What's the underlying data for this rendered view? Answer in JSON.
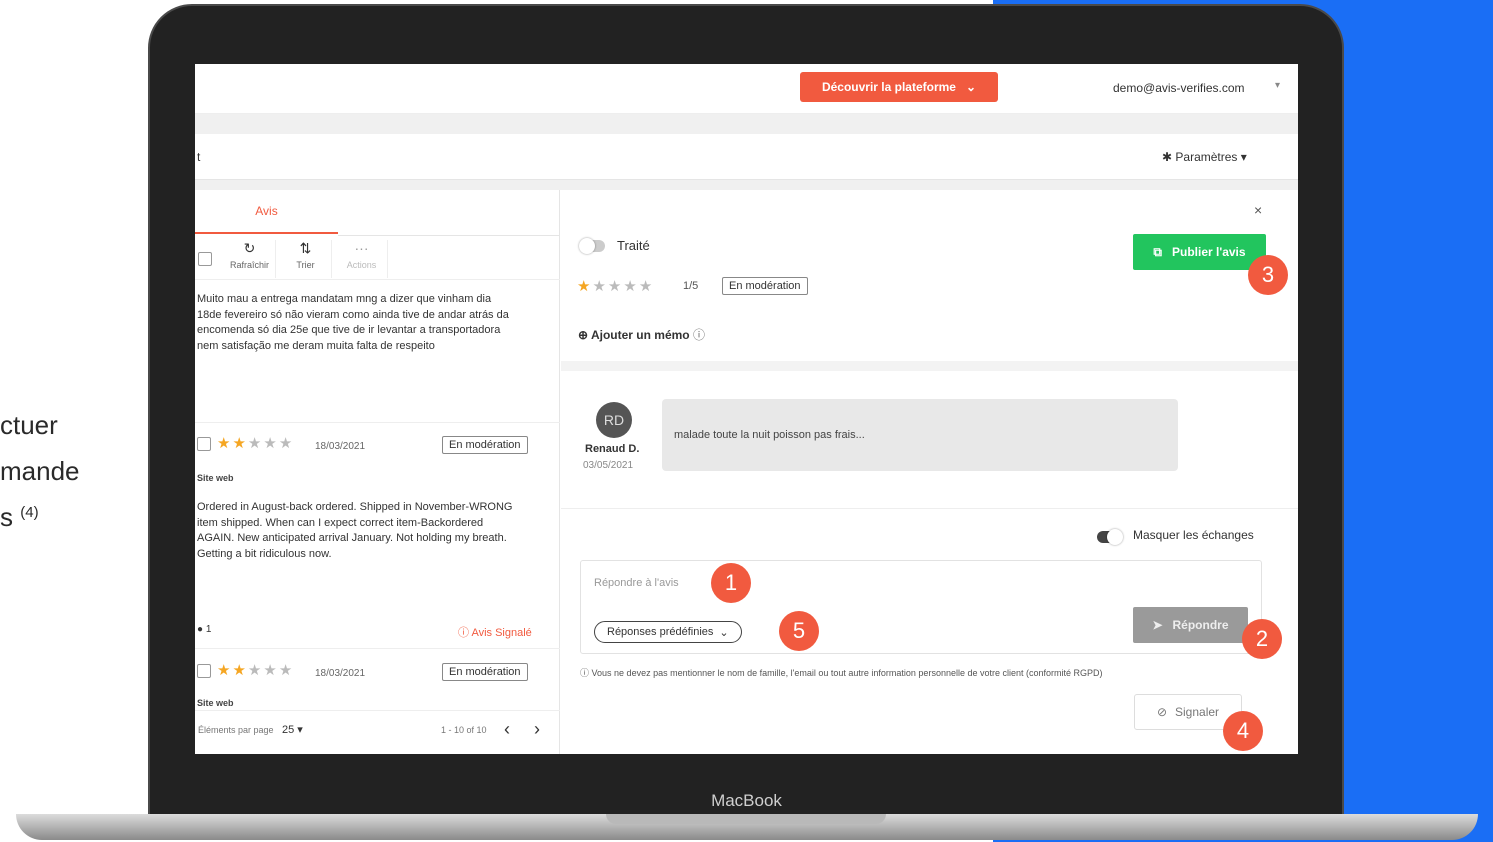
{
  "side_text": {
    "line1": "ctuer",
    "line2": "mande",
    "line3": "s",
    "sup": "(4)"
  },
  "device": {
    "brand": "MacBook"
  },
  "header": {
    "discover_label": "Découvrir la plateforme",
    "user_email": "demo@avis-verifies.com",
    "params_label": "Paramètres",
    "sliver": "t"
  },
  "left": {
    "tab_label": "Avis",
    "tools": [
      {
        "label": "Rafraîchir",
        "icon": "refresh-icon",
        "glyph": "↻"
      },
      {
        "label": "Trier",
        "icon": "sort-icon",
        "glyph": "⇅"
      },
      {
        "label": "Actions",
        "icon": "more-icon",
        "glyph": "···"
      }
    ],
    "review1_text": "Muito mau a entrega mandatam mng a dizer que vinham dia 18de fevereiro só não vieram como ainda tive de andar atrás da encomenda só dia 25e que tive de ir levantar a transportadora nem satisfação me deram muita falta de respeito",
    "review2": {
      "rating": 2,
      "date": "18/03/2021",
      "status": "En modération",
      "source": "Site web",
      "text": "Ordered in August-back ordered. Shipped in November-WRONG item shipped. When can I expect correct item-Backordered AGAIN. New anticipated arrival January. Not holding my breath. Getting a bit ridiculous now.",
      "comments": "1",
      "flag": "Avis Signalé"
    },
    "review3": {
      "rating": 2,
      "date": "18/03/2021",
      "status": "En modération",
      "source": "Site web"
    },
    "pager": {
      "per_page_label": "Éléments par page",
      "per_page": "25",
      "range": "1 - 10 of 10"
    }
  },
  "right": {
    "close": "×",
    "traite_label": "Traité",
    "publish_label": "Publier l'avis",
    "rating": 1,
    "rating_text": "1/5",
    "status": "En modération",
    "memo_label": "Ajouter un mémo",
    "author": {
      "initials": "RD",
      "name": "Renaud D.",
      "date": "03/05/2021"
    },
    "review_text": "malade toute la nuit poisson pas frais...",
    "masquer_label": "Masquer les échanges",
    "reply_placeholder": "Répondre à l'avis",
    "predef_label": "Réponses prédéfinies",
    "repondre_label": "Répondre",
    "rgpd_note": "Vous ne devez pas mentionner le nom de famille, l'email ou tout autre information personnelle de votre client (conformité RGPD)",
    "signaler_label": "Signaler"
  },
  "markers": [
    "1",
    "2",
    "3",
    "4",
    "5"
  ],
  "colors": {
    "accent": "#f15a3f",
    "publish": "#22c55e",
    "blue": "#1a6ef5",
    "star": "#f5a623"
  }
}
